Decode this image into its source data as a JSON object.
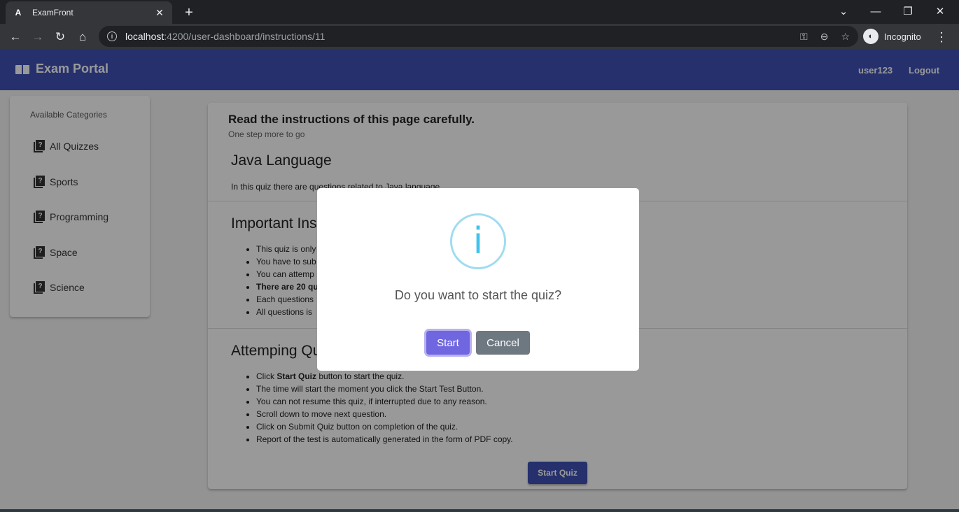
{
  "browser": {
    "tab_title": "ExamFront",
    "tab_close": "✕",
    "new_tab": "+",
    "url_host": "localhost",
    "url_path": ":4200/user-dashboard/instructions/11",
    "profile_label": "Incognito",
    "window_controls": {
      "minimize": "—",
      "restore": "❐",
      "close": "✕",
      "tabsearch": "⌄"
    }
  },
  "appbar": {
    "brand": "Exam Portal",
    "user": "user123",
    "logout": "Logout",
    "color": "#3f51b5"
  },
  "sidebar": {
    "title": "Available Categories",
    "items": [
      {
        "label": "All Quizzes"
      },
      {
        "label": "Sports"
      },
      {
        "label": "Programming"
      },
      {
        "label": "Space"
      },
      {
        "label": "Science"
      }
    ]
  },
  "card": {
    "title": "Read the instructions of this page carefully.",
    "subtitle": "One step more to go",
    "quiz_title": "Java Language",
    "quiz_description": "In this quiz there are questions related to Java language.",
    "important_heading": "Important Ins",
    "important_items": [
      "This quiz is only",
      "You have to sub",
      "You can attemp",
      "There are 20 qu",
      "Each questions",
      "All questions is"
    ],
    "attempting_heading": "Attemping Qu",
    "attempting_items": [
      {
        "bold": "Start Quiz",
        "text": " button to start the quiz.",
        "prefix": "Click "
      },
      {
        "prefix": "",
        "bold": "",
        "text": "The time will start the moment you click the Start Test Button."
      },
      {
        "prefix": "",
        "bold": "",
        "text": "You can not resume this quiz, if interrupted due to any reason."
      },
      {
        "prefix": "",
        "bold": "",
        "text": "Scroll down to move next question."
      },
      {
        "prefix": "",
        "bold": "",
        "text": "Click on Submit Quiz button on completion of the quiz."
      },
      {
        "prefix": "",
        "bold": "",
        "text": "Report of the test is automatically generated in the form of PDF copy."
      }
    ],
    "start_button": "Start Quiz"
  },
  "modal": {
    "icon": "i",
    "question": "Do you want to start the quiz?",
    "confirm": "Start",
    "cancel": "Cancel",
    "confirm_color": "#7066e0",
    "cancel_color": "#6e7881"
  }
}
